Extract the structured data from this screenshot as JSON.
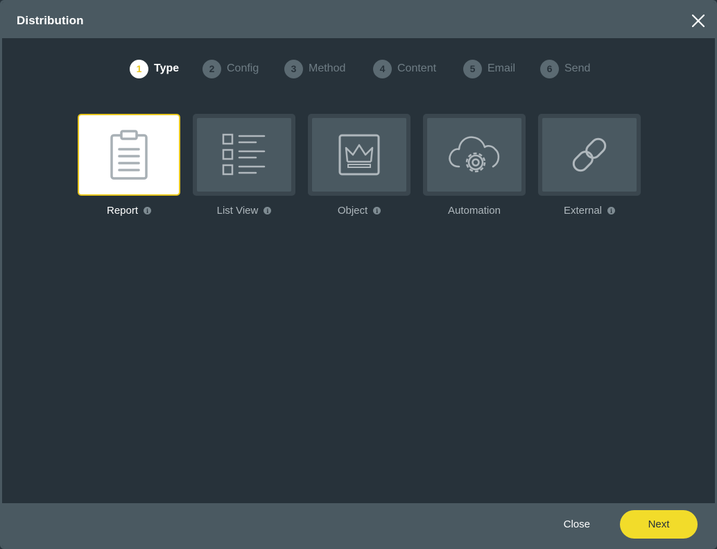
{
  "dialog": {
    "title": "Distribution",
    "close_icon": "close-icon"
  },
  "steps": [
    {
      "number": "1",
      "label": "Type",
      "active": true
    },
    {
      "number": "2",
      "label": "Config",
      "active": false
    },
    {
      "number": "3",
      "label": "Method",
      "active": false
    },
    {
      "number": "4",
      "label": "Content",
      "active": false
    },
    {
      "number": "5",
      "label": "Email",
      "active": false
    },
    {
      "number": "6",
      "label": "Send",
      "active": false
    }
  ],
  "types": [
    {
      "label": "Report",
      "icon": "clipboard-icon",
      "selected": true,
      "info": true
    },
    {
      "label": "List View",
      "icon": "list-icon",
      "selected": false,
      "info": true
    },
    {
      "label": "Object",
      "icon": "crown-icon",
      "selected": false,
      "info": true
    },
    {
      "label": "Automation",
      "icon": "cloud-gear-icon",
      "selected": false,
      "info": false
    },
    {
      "label": "External",
      "icon": "link-icon",
      "selected": false,
      "info": true
    }
  ],
  "info_glyph": "i",
  "footer": {
    "close_label": "Close",
    "next_label": "Next"
  },
  "colors": {
    "accent": "#f2dc2a",
    "background": "#27323a",
    "panel": "#4a5961"
  }
}
